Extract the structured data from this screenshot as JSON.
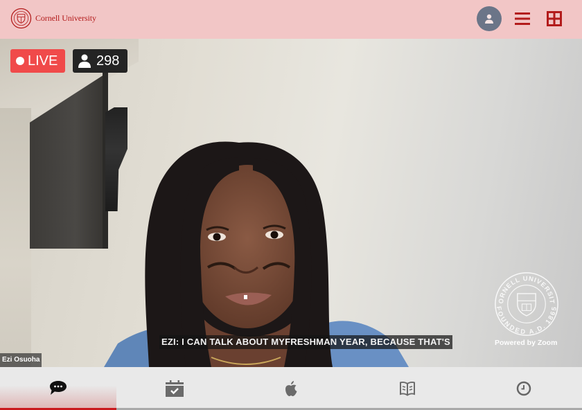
{
  "header": {
    "brand": "Cornell University",
    "profile_icon": "user-avatar-icon",
    "menu_icon": "hamburger-menu-icon",
    "grid_icon": "grid-view-icon",
    "accent_color": "#b31b1b",
    "background_color": "#f2c6c6"
  },
  "video": {
    "live_label": "LIVE",
    "viewer_count": "298",
    "speaker_name": "Ezi Osuoha",
    "caption": "EZI: I CAN TALK ABOUT MYFRESHMAN YEAR, BECAUSE THAT'S",
    "watermark_top": "CORNELL UNIVERSITY",
    "watermark_bottom": "FOUNDED A.D. 1865",
    "powered_by": "Powered by Zoom",
    "live_color": "#f04a4a"
  },
  "tabs": [
    {
      "icon": "chat-bubble-icon",
      "active": true
    },
    {
      "icon": "calendar-check-icon",
      "active": false
    },
    {
      "icon": "apple-icon",
      "active": false
    },
    {
      "icon": "open-book-icon",
      "active": false
    },
    {
      "icon": "clock-icon",
      "active": false
    }
  ]
}
